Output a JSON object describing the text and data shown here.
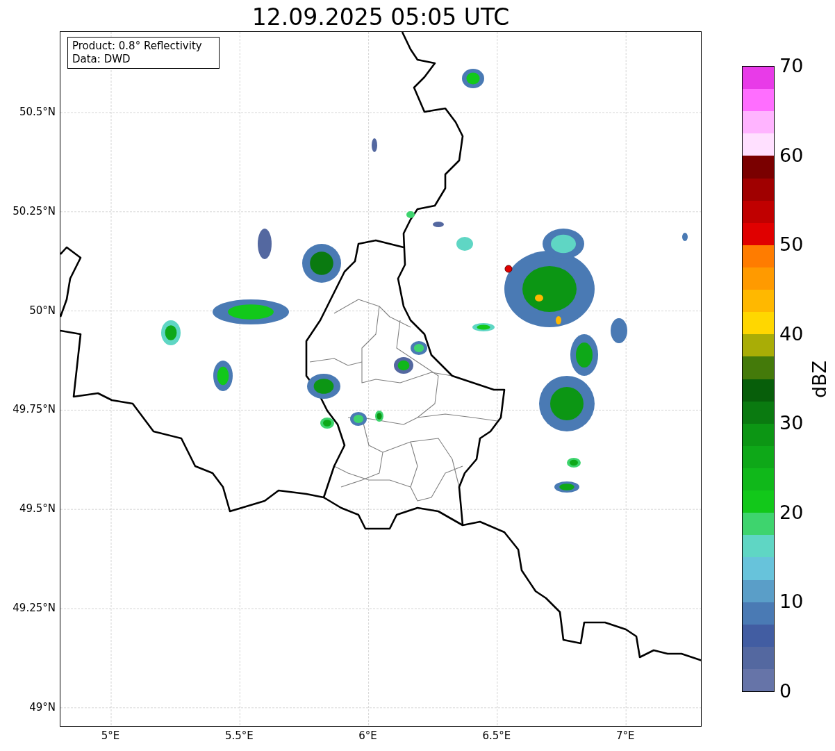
{
  "title": "12.09.2025 05:05 UTC",
  "info_box": [
    "Product: 0.8° Reflectivity",
    "Data: DWD"
  ],
  "map": {
    "yticks": [
      "50.5°N",
      "50.25°N",
      "50°N",
      "49.75°N",
      "49.5°N",
      "49.25°N",
      "49°N"
    ],
    "xticks": [
      "5°E",
      "5.5°E",
      "6°E",
      "6.5°E",
      "7°E"
    ]
  },
  "colorbar": {
    "label": "dBZ",
    "ticks": [
      "70",
      "60",
      "50",
      "40",
      "30",
      "20",
      "10",
      "0"
    ],
    "bands": [
      {
        "color": "#e83be8"
      },
      {
        "color": "#ff6eff"
      },
      {
        "color": "#ffb4ff"
      },
      {
        "color": "#ffe0ff"
      },
      {
        "color": "#7a0000"
      },
      {
        "color": "#a00000"
      },
      {
        "color": "#c00000"
      },
      {
        "color": "#e00000"
      },
      {
        "color": "#ff7c00"
      },
      {
        "color": "#ff9a00"
      },
      {
        "color": "#ffb800"
      },
      {
        "color": "#ffd700"
      },
      {
        "color": "#a9ad06"
      },
      {
        "color": "#447a0a"
      },
      {
        "color": "#075e0a"
      },
      {
        "color": "#0a7a10"
      },
      {
        "color": "#0c9614"
      },
      {
        "color": "#0ea818"
      },
      {
        "color": "#10b81a"
      },
      {
        "color": "#12c81a"
      },
      {
        "color": "#3ed46e"
      },
      {
        "color": "#5fd6c4"
      },
      {
        "color": "#67c3db"
      },
      {
        "color": "#5a9ec8"
      },
      {
        "color": "#4a7ab4"
      },
      {
        "color": "#425da2"
      },
      {
        "color": "#5468a0"
      },
      {
        "color": "#6674a8"
      }
    ]
  }
}
